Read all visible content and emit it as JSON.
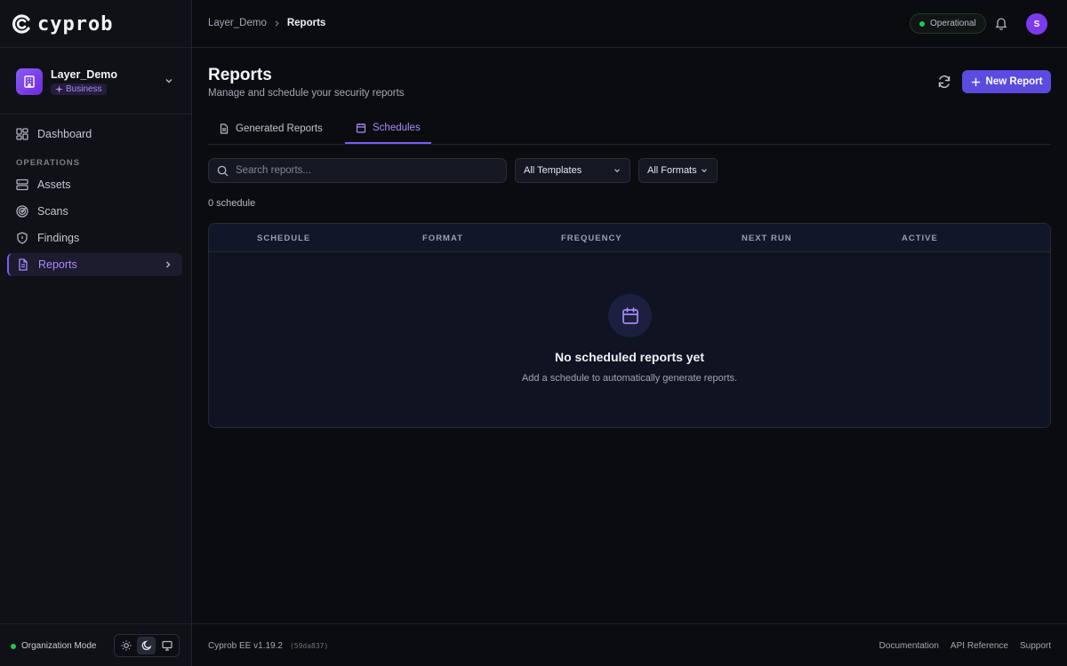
{
  "brand": {
    "name": "cyprob"
  },
  "org": {
    "name": "Layer_Demo",
    "plan": "Business"
  },
  "sidebar": {
    "section_label": "OPERATIONS",
    "items": [
      {
        "label": "Dashboard",
        "icon": "dashboard-icon"
      },
      {
        "label": "Assets",
        "icon": "server-icon"
      },
      {
        "label": "Scans",
        "icon": "radar-icon"
      },
      {
        "label": "Findings",
        "icon": "shield-icon"
      },
      {
        "label": "Reports",
        "icon": "file-text-icon",
        "active": true
      }
    ],
    "footer": {
      "mode_label": "Organization Mode"
    }
  },
  "header": {
    "breadcrumb": [
      "Layer_Demo",
      "Reports"
    ],
    "status": "Operational",
    "user_initial": "S"
  },
  "page": {
    "title": "Reports",
    "subtitle": "Manage and schedule your security reports",
    "new_button": "New Report"
  },
  "tabs": [
    {
      "label": "Generated Reports",
      "active": false
    },
    {
      "label": "Schedules",
      "active": true
    }
  ],
  "filters": {
    "search_placeholder": "Search reports...",
    "template": "All Templates",
    "format": "All Formats"
  },
  "count_text": "0 schedule",
  "table": {
    "columns": [
      "SCHEDULE",
      "FORMAT",
      "FREQUENCY",
      "NEXT RUN",
      "ACTIVE"
    ],
    "empty_title": "No scheduled reports yet",
    "empty_subtitle": "Add a schedule to automatically generate reports."
  },
  "footer": {
    "version": "Cyprob EE v1.19.2",
    "hash": "(59da837)",
    "links": [
      "Documentation",
      "API Reference",
      "Support"
    ]
  },
  "colors": {
    "accent": "#7c5cf6",
    "button": "#5b4be0",
    "success": "#22c55e"
  }
}
